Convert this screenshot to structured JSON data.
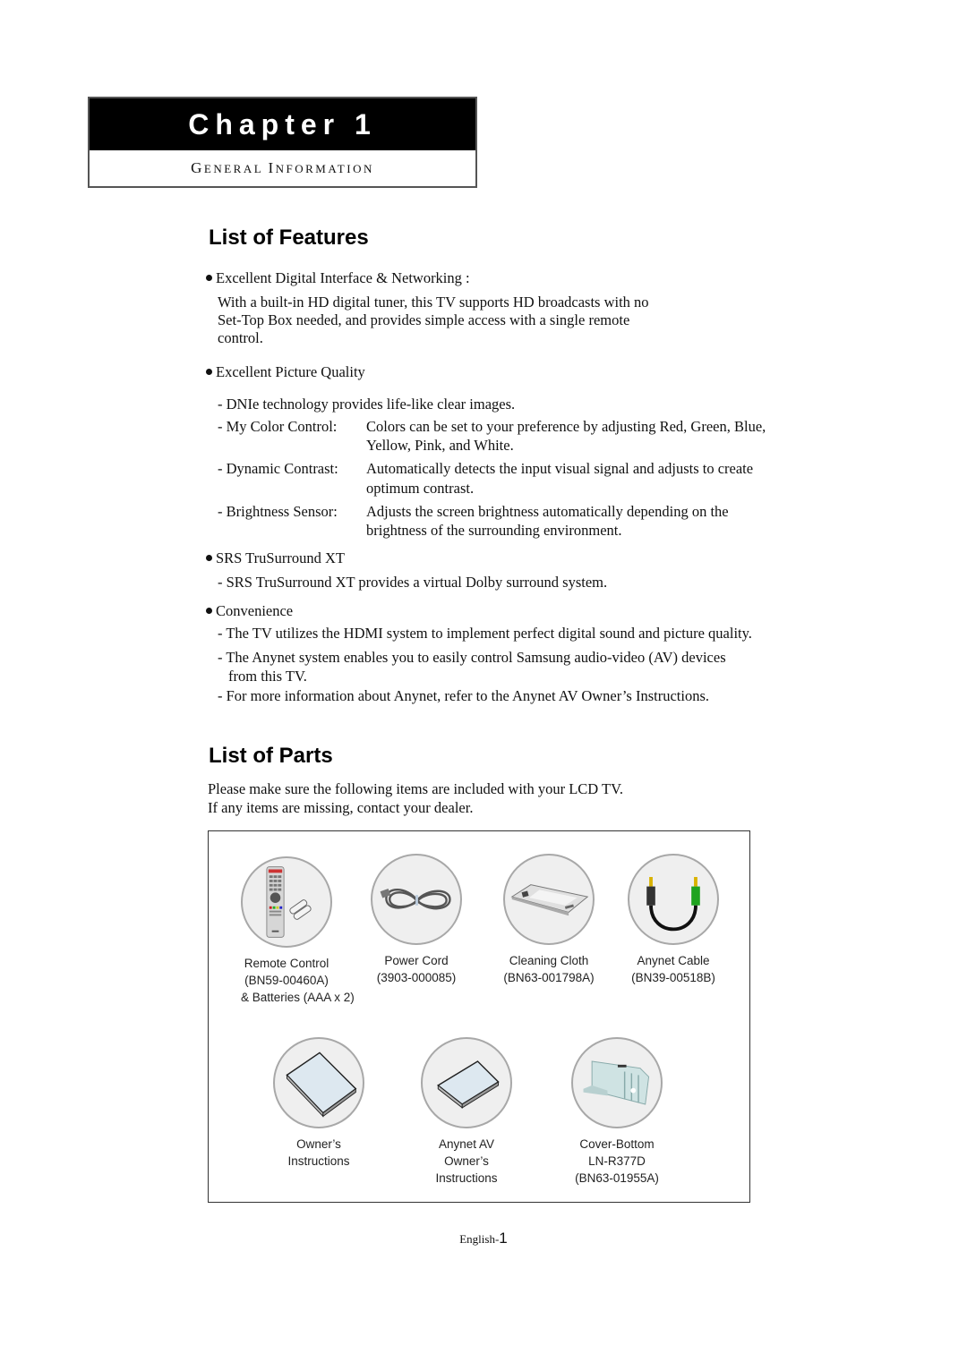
{
  "chapter": {
    "title": "Chapter 1",
    "subtitle_first_G": "G",
    "subtitle_rest1": "ENERAL ",
    "subtitle_first_I": "I",
    "subtitle_rest2": "NFORMATION"
  },
  "features": {
    "heading": "List of Features",
    "items": [
      {
        "bullet": "Excellent Digital Interface & Networking :",
        "para": [
          "With a built-in HD digital tuner, this TV supports HD broadcasts with no",
          "Set-Top Box needed, and provides simple access with a single remote",
          "control."
        ]
      },
      {
        "bullet": "Excellent Picture Quality",
        "simple": "- DNIe technology provides life-like clear images.",
        "subs": [
          {
            "term": "- My Color Control:",
            "lines": [
              "Colors can be set to your preference by adjusting Red, Green, Blue,",
              "Yellow, Pink, and White."
            ]
          },
          {
            "term": "- Dynamic Contrast:",
            "lines": [
              "Automatically detects the input visual signal and adjusts to create",
              "optimum contrast."
            ]
          },
          {
            "term": "- Brightness Sensor:",
            "lines": [
              "Adjusts the screen brightness automatically depending on the",
              "brightness of the surrounding environment."
            ]
          }
        ]
      },
      {
        "bullet": "SRS TruSurround XT",
        "lines": [
          "- SRS TruSurround XT provides a virtual Dolby surround system."
        ]
      },
      {
        "bullet": "Convenience",
        "lines": [
          "- The TV utilizes the HDMI system to implement perfect digital sound and picture quality.",
          "- The Anynet system enables you to easily control Samsung audio-video (AV) devices",
          "  from this TV.",
          "- For more information about Anynet, refer to the Anynet AV Owner’s Instructions."
        ]
      }
    ]
  },
  "parts": {
    "heading": "List of Parts",
    "intro": [
      "Please make sure the following items are included with your LCD TV.",
      "If any items are missing, contact your dealer."
    ],
    "items": [
      {
        "icon": "remote-control-icon",
        "lines": [
          "Remote Control",
          "(BN59-00460A)",
          "& Batteries (AAA x 2)"
        ]
      },
      {
        "icon": "power-cord-icon",
        "lines": [
          "Power Cord",
          "(3903-000085)"
        ]
      },
      {
        "icon": "cleaning-cloth-icon",
        "lines": [
          "Cleaning Cloth",
          "(BN63-001798A)"
        ]
      },
      {
        "icon": "anynet-cable-icon",
        "lines": [
          "Anynet Cable",
          "(BN39-00518B)"
        ]
      },
      {
        "icon": "owners-instructions-icon",
        "lines": [
          "Owner’s",
          "Instructions"
        ]
      },
      {
        "icon": "anynet-av-manual-icon",
        "lines": [
          "Anynet AV",
          "Owner’s",
          "Instructions"
        ]
      },
      {
        "icon": "cover-bottom-icon",
        "lines": [
          "Cover-Bottom",
          "LN-R377D",
          "(BN63-01955A)"
        ]
      }
    ]
  },
  "footer": {
    "lang": "English-",
    "page": "1"
  }
}
